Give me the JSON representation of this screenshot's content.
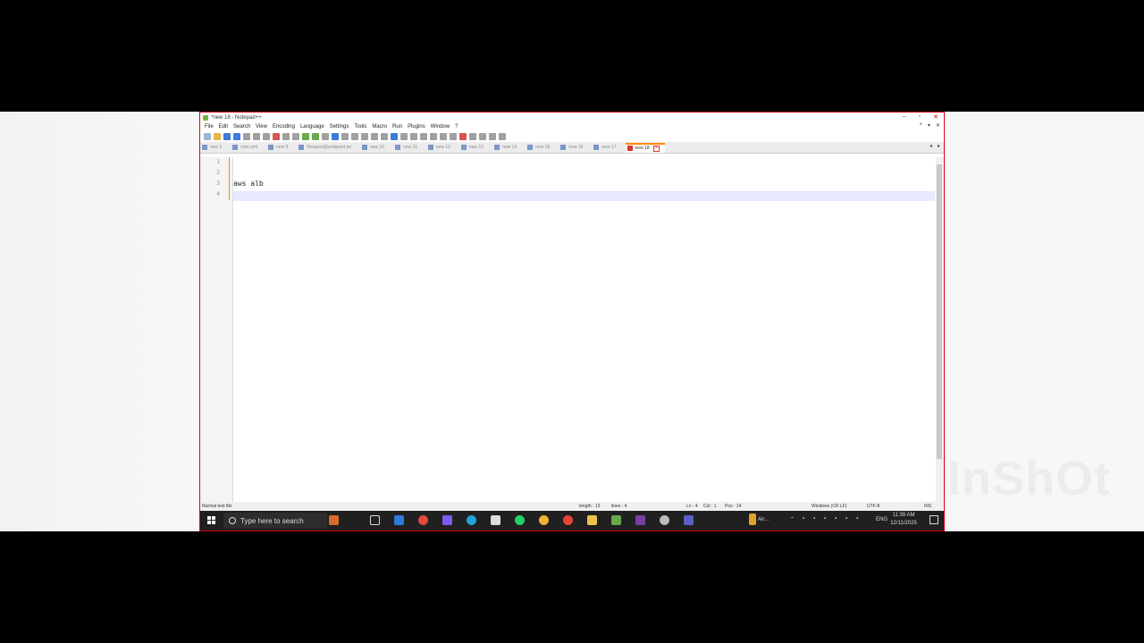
{
  "window": {
    "title": "*new 18 - Notepad++",
    "menu": [
      "File",
      "Edit",
      "Search",
      "View",
      "Encoding",
      "Language",
      "Settings",
      "Tools",
      "Macro",
      "Run",
      "Plugins",
      "Window",
      "?"
    ],
    "tabs": [
      {
        "label": "new 1",
        "active": false
      },
      {
        "label": "com.xml",
        "active": false
      },
      {
        "label": "new 9",
        "active": false
      },
      {
        "label": "Request@endpoint.txt",
        "active": false
      },
      {
        "label": "new 10",
        "active": false
      },
      {
        "label": "new 11",
        "active": false
      },
      {
        "label": "new 12",
        "active": false
      },
      {
        "label": "new 13",
        "active": false
      },
      {
        "label": "new 14",
        "active": false
      },
      {
        "label": "new 15",
        "active": false
      },
      {
        "label": "new 16",
        "active": false
      },
      {
        "label": "new 17",
        "active": false
      },
      {
        "label": "new 18",
        "active": true
      }
    ]
  },
  "editor": {
    "line_numbers": [
      "1",
      "2",
      "3",
      "4"
    ],
    "lines": [
      "",
      "",
      "aws alb",
      ""
    ]
  },
  "status": {
    "file_type": "Normal text file",
    "length": "length : 13",
    "lines": "lines : 4",
    "ln": "Ln : 4",
    "col": "Col : 1",
    "pos": "Pos : 14",
    "eol": "Windows (CR LF)",
    "encoding": "UTF-8",
    "mode": "INS"
  },
  "taskbar": {
    "search_placeholder": "Type here to search",
    "weather": "Air...",
    "lang": "ENG",
    "time": "11:39 AM",
    "date": "12/11/2025"
  },
  "watermark": "InShOt",
  "colors": {
    "accent": "#ff8a00",
    "frame": "#d9001b",
    "taskbar": "#202020"
  }
}
